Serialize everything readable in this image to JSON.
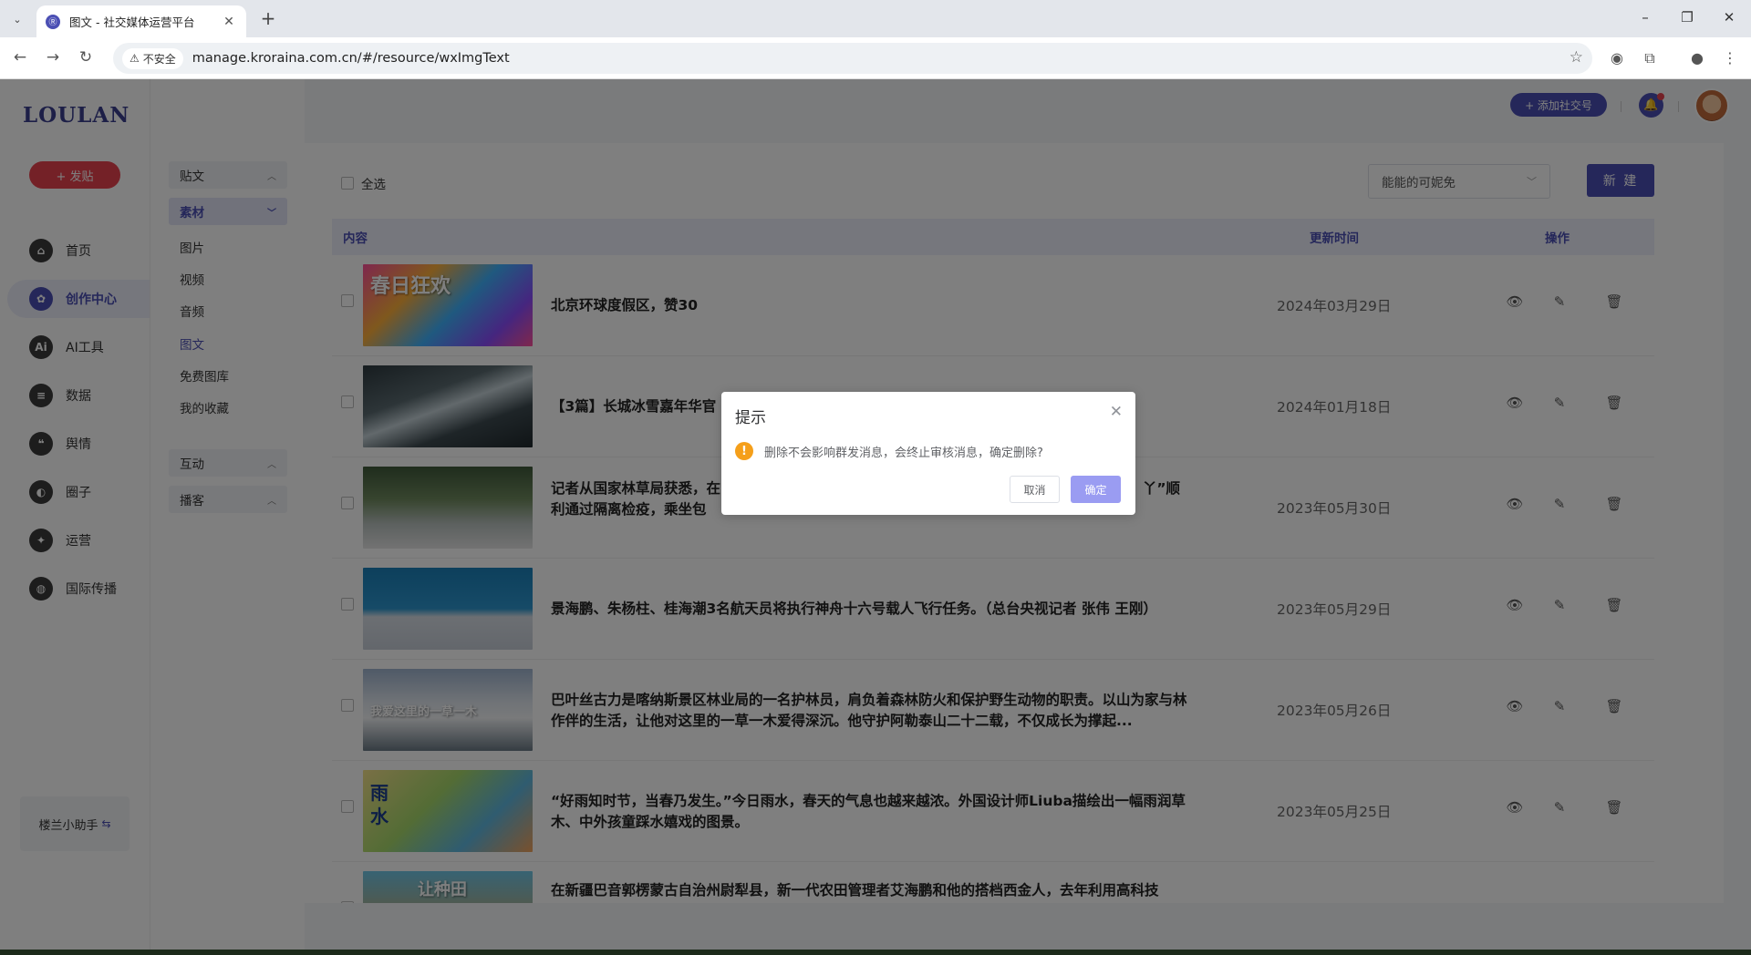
{
  "browser": {
    "tab_title": "图文 - 社交媒体运营平台",
    "tab_favicon": "Ⓡ",
    "insecure_label": "不安全",
    "url": "manage.kroraina.com.cn/#/resource/wxImgText"
  },
  "app": {
    "logo": "LOULAN",
    "post_button": "+ 发贴",
    "nav": [
      {
        "label": "首页",
        "icon": "⌂"
      },
      {
        "label": "创作中心",
        "icon": "✿"
      },
      {
        "label": "AI工具",
        "icon": "Ai"
      },
      {
        "label": "数据",
        "icon": "≡"
      },
      {
        "label": "舆情",
        "icon": "❝"
      },
      {
        "label": "圈子",
        "icon": "◐"
      },
      {
        "label": "运营",
        "icon": "✦"
      },
      {
        "label": "国际传播",
        "icon": "◍"
      }
    ],
    "assistant": "楼兰小助手",
    "assistant_icon": "⇆",
    "subnav": {
      "group_posts": "贴文",
      "group_material": "素材",
      "items": [
        "图片",
        "视频",
        "音频",
        "图文",
        "免费图库",
        "我的收藏"
      ],
      "group_interact": "互动",
      "group_broadcast": "播客"
    },
    "top": {
      "add_social": "+ 添加社交号",
      "bell_icon": "🔔"
    }
  },
  "content": {
    "select_all": "全选",
    "account_select": "能能的可妮免",
    "new_button": "新 建",
    "columns": {
      "content": "内容",
      "time": "更新时间",
      "action": "操作"
    },
    "rows": [
      {
        "title": "北京环球度假区，赞30",
        "date": "2024年03月29日",
        "thumb_label": "春日狂欢"
      },
      {
        "title": "【3篇】长城冰雪嘉年华官",
        "date": "2024年01月18日",
        "thumb_label": ""
      },
      {
        "title": "记者从国家林草局获悉，在",
        "title_tail": "丫”顺",
        "title2": "利通过隔离检疫，乘坐包",
        "date": "2023年05月30日",
        "thumb_label": ""
      },
      {
        "title": "景海鹏、朱杨柱、桂海潮3名航天员将执行神舟十六号载人飞行任务。（总台央视记者 张伟 王刚）",
        "date": "2023年05月29日",
        "thumb_label": ""
      },
      {
        "title": "巴叶丝古力是喀纳斯景区林业局的一名护林员，肩负着森林防火和保护野生动物的职责。以山为家与林作伴的生活，让他对这里的一草一木爱得深沉。他守护阿勒泰山二十二载，不仅成长为撑起...",
        "date": "2023年05月26日",
        "thumb_label": "我爱这里的一草一木"
      },
      {
        "title": "“好雨知时节，当春乃发生。”今日雨水，春天的气息也越来越浓。外国设计师Liuba描绘出一幅雨润草木、中外孩童踩水嬉戏的图景。",
        "date": "2023年05月25日",
        "thumb_label": "雨水"
      },
      {
        "title": "在新疆巴音郭楞蒙古自治州尉犁县，新一代农田管理者艾海鹏和他的搭档西金人，去年利用高科技",
        "date": "",
        "thumb_label": "让种田"
      }
    ],
    "action_icons": {
      "view": "👁",
      "edit": "✎",
      "delete": "🗑"
    }
  },
  "dialog": {
    "title": "提示",
    "message": "删除不会影响群发消息，会终止审核消息，确定删除?",
    "cancel": "取消",
    "confirm": "确定",
    "close_icon": "✕",
    "warn_icon": "!"
  },
  "colors": {
    "brand": "#4b4fb4",
    "danger": "#e8424f",
    "warning": "#f59f1a"
  }
}
